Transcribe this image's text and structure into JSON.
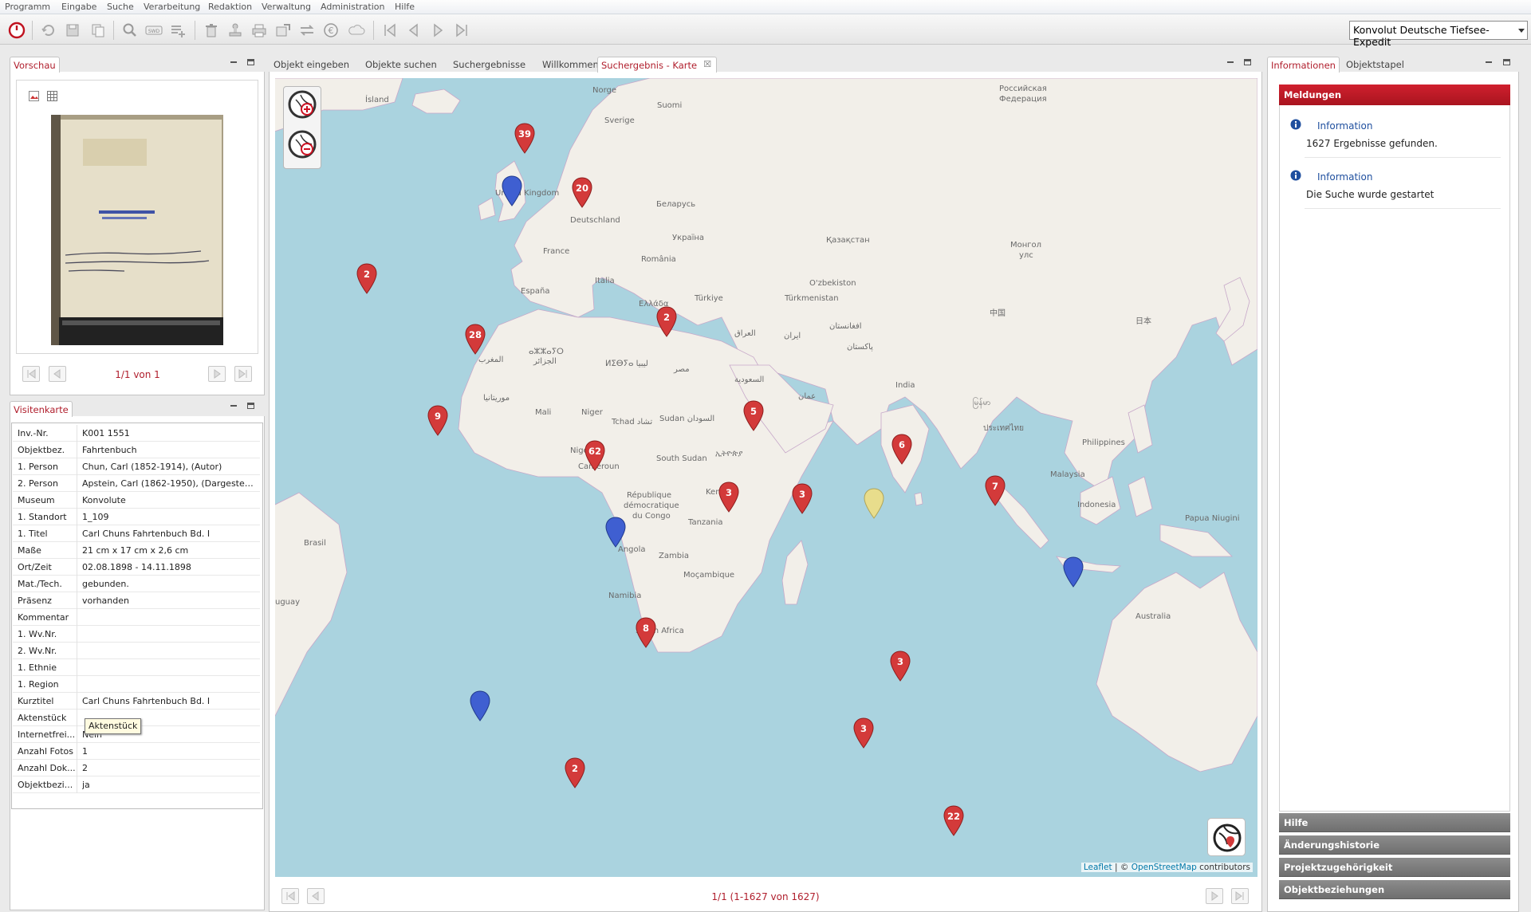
{
  "menu": [
    "Programm",
    "Eingabe",
    "Suche",
    "Verarbeitung",
    "Redaktion",
    "Verwaltung",
    "Administration",
    "Hilfe"
  ],
  "konvolut_select": "Konvolut Deutsche Tiefsee-Expedit",
  "preview": {
    "tab": "Vorschau",
    "pager": "1/1 von 1"
  },
  "visitenkarte": {
    "tab": "Visitenkarte",
    "rows": [
      {
        "k": "Inv.-Nr.",
        "v": "K001 1551"
      },
      {
        "k": "Objektbez.",
        "v": "Fahrtenbuch"
      },
      {
        "k": "1. Person",
        "v": "Chun, Carl (1852-1914), (Autor)"
      },
      {
        "k": "2. Person",
        "v": "Apstein, Carl (1862-1950), (Dargestellt..."
      },
      {
        "k": "Museum",
        "v": "Konvolute"
      },
      {
        "k": "1. Standort",
        "v": "1_109"
      },
      {
        "k": "1. Titel",
        "v": "Carl Chuns Fahrtenbuch Bd. I"
      },
      {
        "k": "Maße",
        "v": "21 cm x 17 cm x 2,6 cm"
      },
      {
        "k": "Ort/Zeit",
        "v": "02.08.1898 - 14.11.1898"
      },
      {
        "k": "Mat./Tech.",
        "v": "gebunden."
      },
      {
        "k": "Präsenz",
        "v": "vorhanden"
      },
      {
        "k": "Kommentar",
        "v": ""
      },
      {
        "k": "1. Wv.Nr.",
        "v": ""
      },
      {
        "k": "2. Wv.Nr.",
        "v": ""
      },
      {
        "k": "1. Ethnie",
        "v": ""
      },
      {
        "k": "1. Region",
        "v": ""
      },
      {
        "k": "Kurztitel",
        "v": "Carl Chuns Fahrtenbuch Bd. I"
      },
      {
        "k": "Aktenstück",
        "v": ""
      },
      {
        "k": "Internetfrei...",
        "v": "Nein"
      },
      {
        "k": "Anzahl Fotos",
        "v": "1"
      },
      {
        "k": "Anzahl Dok...",
        "v": "2"
      },
      {
        "k": "Objektbezi...",
        "v": "ja"
      }
    ],
    "tooltip": "Aktenstück"
  },
  "main_tabs": [
    "Objekt eingeben",
    "Objekte suchen",
    "Suchergebnisse",
    "Willkommen",
    "Suchergebnis - Karte"
  ],
  "map": {
    "attribution_link1": "Leaflet",
    "attribution_sep": " | © ",
    "attribution_link2": "OpenStreetMap",
    "attribution_tail": " contributors",
    "pager": "1/1 (1-1627 von 1627)",
    "labels": {
      "island": "Ísland",
      "norge": "Norge",
      "sverige": "Sverige",
      "suomi": "Suomi",
      "uk": "United Kingdom",
      "deutschland": "Deutschland",
      "belarus": "Беларусь",
      "ukraina": "Україна",
      "romania": "România",
      "france": "France",
      "espana": "España",
      "italia": "Italia",
      "turkiye": "Türkiye",
      "ellada": "Ελλάδα",
      "russia1": "Российская",
      "russia2": "Федерация",
      "kazakhstan": "Қазақстан",
      "mongol1": "Монгол",
      "mongol2": "улс",
      "uzbekiston": "O'zbekiston",
      "turkmenistan": "Türkmenistan",
      "china": "中国",
      "japan": "日本",
      "iran": "ایران",
      "iraq": "العراق",
      "afghanistan": "افغانستان",
      "pakistan": "پاکستان",
      "india": "India",
      "saudi": "السعودية",
      "oman": "عمان",
      "myanmar": "မြန်မာ",
      "thailand": "ประเทศไทย",
      "philippines": "Philippines",
      "malaysia": "Malaysia",
      "indonesia": "Indonesia",
      "png": "Papua Niugini",
      "australia": "Australia",
      "egypt": "مصر",
      "libya": "ⵍⵉⴱⵢⴰ ليبيا",
      "algeria1": "ⴰⵣⵣⴰⵢⵔ",
      "algeria2": "الجزائر",
      "morocco": "المغرب",
      "mauritania": "موريتانيا",
      "mali": "Mali",
      "niger": "Niger",
      "tchad": "Tchad تشاد",
      "sudan": "Sudan السودان",
      "south_sudan": "South Sudan",
      "ethiopia": "ኢትዮጵያ",
      "nigeria": "Nigeria",
      "cameroun": "Cameroun",
      "rdc1": "République",
      "rdc2": "démocratique",
      "rdc3": "du Congo",
      "kenya": "Kenya",
      "tanzania": "Tanzania",
      "angola": "Angola",
      "zambia": "Zambia",
      "mocambique": "Moçambique",
      "namibia": "Namibia",
      "south_africa": "South Africa",
      "brasil": "Brasil",
      "uruguay": "uguay"
    },
    "markers": [
      {
        "n": "39"
      },
      {
        "n": "20"
      },
      {
        "n": "2"
      },
      {
        "n": "28"
      },
      {
        "n": "2"
      },
      {
        "n": "9"
      },
      {
        "n": "62"
      },
      {
        "n": "5"
      },
      {
        "n": "6"
      },
      {
        "n": "3"
      },
      {
        "n": "3"
      },
      {
        "n": "7"
      },
      {
        "n": "8"
      },
      {
        "n": "3"
      },
      {
        "n": "3"
      },
      {
        "n": "2"
      },
      {
        "n": "22"
      }
    ]
  },
  "right": {
    "tabs": [
      "Informationen",
      "Objektstapel"
    ],
    "meldungen_title": "Meldungen",
    "messages": [
      {
        "title": "Information",
        "text": "1627 Ergebnisse gefunden."
      },
      {
        "title": "Information",
        "text": "Die Suche wurde gestartet"
      }
    ],
    "sections": [
      "Hilfe",
      "Änderungshistorie",
      "Projektzugehörigkeit",
      "Objektbeziehungen"
    ]
  },
  "colors": {
    "accent": "#b01e2c",
    "sea": "#aad3df",
    "land": "#f2efe9",
    "pin_red": "#d33a3a",
    "pin_blue": "#3f5fd1",
    "pin_yellow": "#e8dd8c"
  }
}
